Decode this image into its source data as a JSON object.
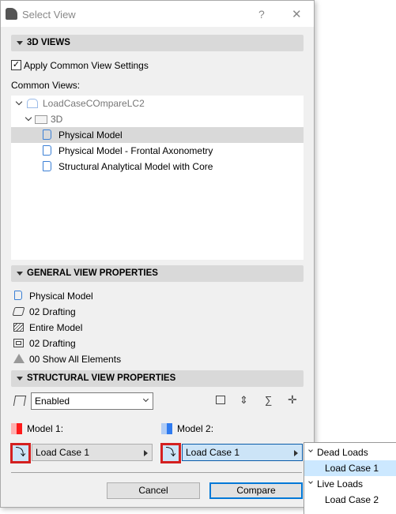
{
  "window": {
    "title": "Select View",
    "help": "?",
    "close": "✕"
  },
  "views3d": {
    "header": "3D VIEWS",
    "apply_common": "Apply Common View Settings",
    "apply_checked": true,
    "common_views_label": "Common Views:",
    "tree": {
      "project": "LoadCaseCOmpareLC2",
      "folder": "3D",
      "items": [
        "Physical Model",
        "Physical Model - Frontal Axonometry",
        "Structural Analytical Model with Core"
      ],
      "selected": "Physical Model"
    }
  },
  "general": {
    "header": "GENERAL VIEW PROPERTIES",
    "items": [
      "Physical Model",
      "02 Drafting",
      "Entire Model",
      "02 Drafting",
      "00 Show All Elements"
    ]
  },
  "structural": {
    "header": "STRUCTURAL VIEW PROPERTIES",
    "dropdown": "Enabled"
  },
  "models": {
    "model1": {
      "label": "Model 1:",
      "load_case": "Load Case 1",
      "color": "#ff1a1a"
    },
    "model2": {
      "label": "Model 2:",
      "load_case": "Load Case 1",
      "color": "#2f7bf0"
    }
  },
  "buttons": {
    "cancel": "Cancel",
    "compare": "Compare"
  },
  "popup": {
    "groups": [
      {
        "label": "Dead Loads",
        "items": [
          "Load Case 1"
        ]
      },
      {
        "label": "Live Loads",
        "items": [
          "Load Case 2"
        ]
      }
    ],
    "selected": "Load Case 1"
  }
}
